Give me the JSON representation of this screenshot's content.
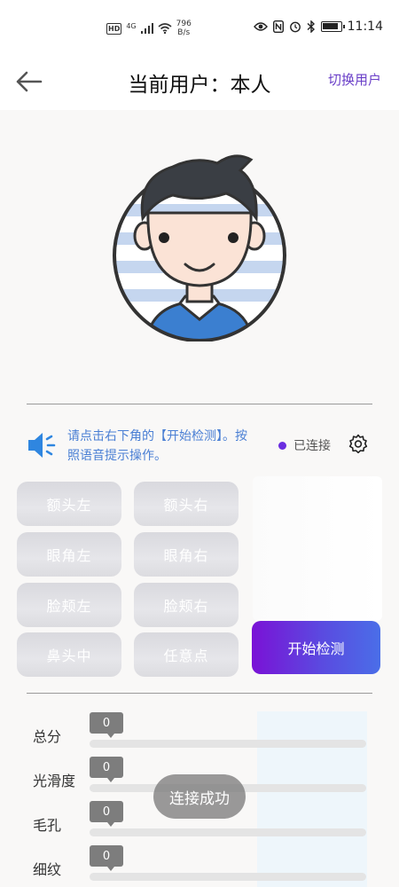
{
  "status_bar": {
    "network_badge": "HD",
    "network_type": "4G",
    "speed_value": "796",
    "speed_unit": "B/s",
    "time": "11:14",
    "battery_level": 0.9
  },
  "header": {
    "title": "当前用户：本人",
    "switch_user": "切换用户"
  },
  "info": {
    "tip": "请点击右下角的【开始检测】。按照语音提示操作。",
    "status": "已连接"
  },
  "regions": [
    "额头左",
    "额头右",
    "眼角左",
    "眼角右",
    "脸颊左",
    "脸颊右",
    "鼻头中",
    "任意点"
  ],
  "start_button": "开始检测",
  "scores": [
    {
      "label": "总分",
      "value": "0"
    },
    {
      "label": "光滑度",
      "value": "0"
    },
    {
      "label": "毛孔",
      "value": "0"
    },
    {
      "label": "细纹",
      "value": "0"
    }
  ],
  "toast": "连接成功",
  "colors": {
    "accent": "#6a3fc8",
    "tip_text": "#4a7fd4",
    "status_dot": "#6a2de0",
    "start_gradient": [
      "#7a12d6",
      "#4a6ee8"
    ]
  }
}
